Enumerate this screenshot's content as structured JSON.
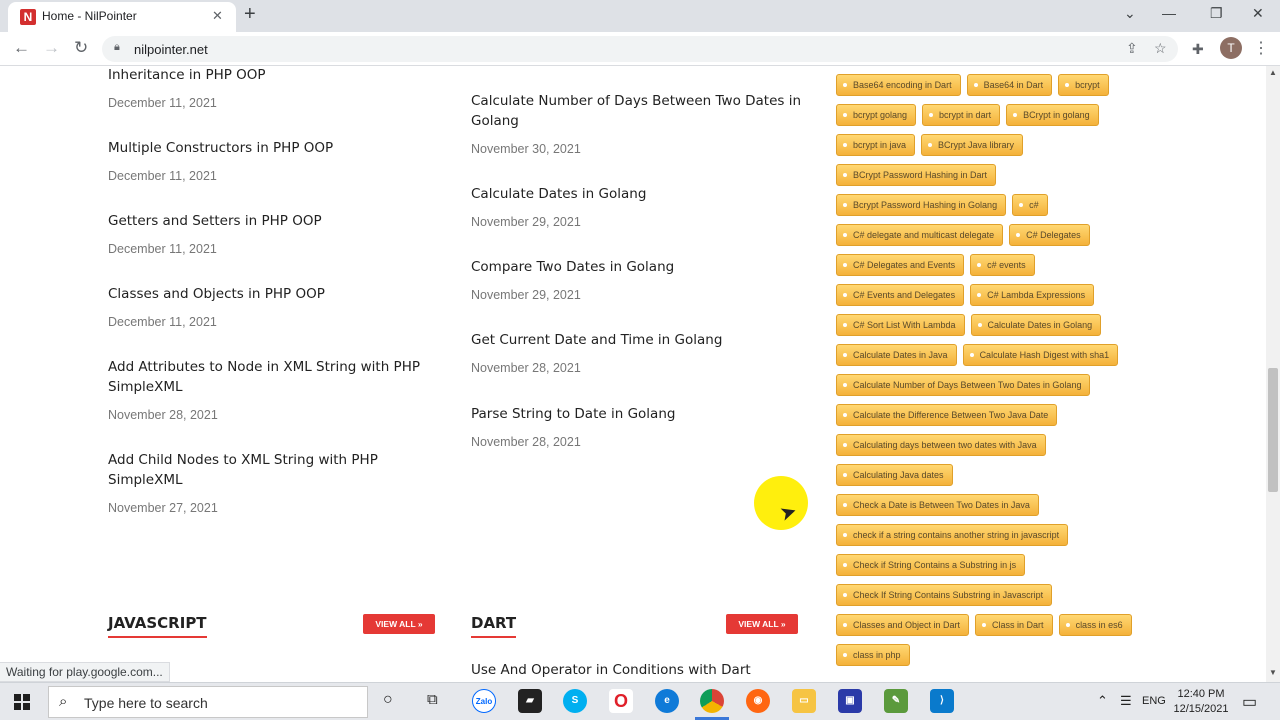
{
  "browser": {
    "tab_title": "Home - NilPointer",
    "tab_favicon": "N",
    "url": "nilpointer.net",
    "profile_initial": "T",
    "status_text": "Waiting for play.google.com..."
  },
  "left_column": {
    "posts": [
      {
        "title": "Inheritance in PHP OOP",
        "date": "December 11, 2021"
      },
      {
        "title": "Multiple Constructors in PHP OOP",
        "date": "December 11, 2021"
      },
      {
        "title": "Getters and Setters in PHP OOP",
        "date": "December 11, 2021"
      },
      {
        "title": "Classes and Objects in PHP OOP",
        "date": "December 11, 2021"
      },
      {
        "title": "Add Attributes to Node in XML String with PHP SimpleXML",
        "date": "November 28, 2021"
      },
      {
        "title": "Add Child Nodes to XML String with PHP SimpleXML",
        "date": "November 27, 2021"
      }
    ]
  },
  "middle_column": {
    "posts": [
      {
        "title": "Calculate Number of Days Between Two Dates in Golang",
        "date": "November 30, 2021"
      },
      {
        "title": "Calculate Dates in Golang",
        "date": "November 29, 2021"
      },
      {
        "title": "Compare Two Dates in Golang",
        "date": "November 29, 2021"
      },
      {
        "title": "Get Current Date and Time in Golang",
        "date": "November 28, 2021"
      },
      {
        "title": "Parse String to Date in Golang",
        "date": "November 28, 2021"
      }
    ]
  },
  "sections": {
    "javascript": {
      "title": "JAVASCRIPT",
      "view_all": "VIEW ALL »"
    },
    "dart": {
      "title": "DART",
      "view_all": "VIEW ALL »",
      "first_post": "Use And Operator in Conditions with Dart"
    }
  },
  "tags": [
    [
      "Base64 encoding in Dart",
      "Base64 in Dart",
      "bcrypt"
    ],
    [
      "bcrypt golang",
      "bcrypt in dart",
      "BCrypt in golang"
    ],
    [
      "bcrypt in java",
      "BCrypt Java library"
    ],
    [
      "BCrypt Password Hashing in Dart"
    ],
    [
      "Bcrypt Password Hashing in Golang",
      "c#"
    ],
    [
      "C# delegate and multicast delegate",
      "C# Delegates"
    ],
    [
      "C# Delegates and Events",
      "c# events"
    ],
    [
      "C# Events and Delegates",
      "C# Lambda Expressions"
    ],
    [
      "C# Sort List With Lambda",
      "Calculate Dates in Golang"
    ],
    [
      "Calculate Dates in Java",
      "Calculate Hash Digest with sha1"
    ],
    [
      "Calculate Number of Days Between Two Dates in Golang"
    ],
    [
      "Calculate the Difference Between Two Java Date"
    ],
    [
      "Calculating days between two dates with Java"
    ],
    [
      "Calculating Java dates"
    ],
    [
      "Check a Date is Between Two Dates in Java"
    ],
    [
      "check if a string contains another string in javascript"
    ],
    [
      "Check if String Contains a Substring in js"
    ],
    [
      "Check If String Contains Substring in Javascript"
    ],
    [
      "Classes and Object in Dart",
      "Class in Dart",
      "class in es6"
    ],
    [
      "class in php"
    ]
  ],
  "taskbar": {
    "search_placeholder": "Type here to search",
    "language": "ENG",
    "time": "12:40 PM",
    "date": "12/15/2021"
  },
  "colors": {
    "accent_red": "#e53935",
    "tag_fill": "#f4b13a",
    "cursor_highlight": "#ffee00"
  }
}
